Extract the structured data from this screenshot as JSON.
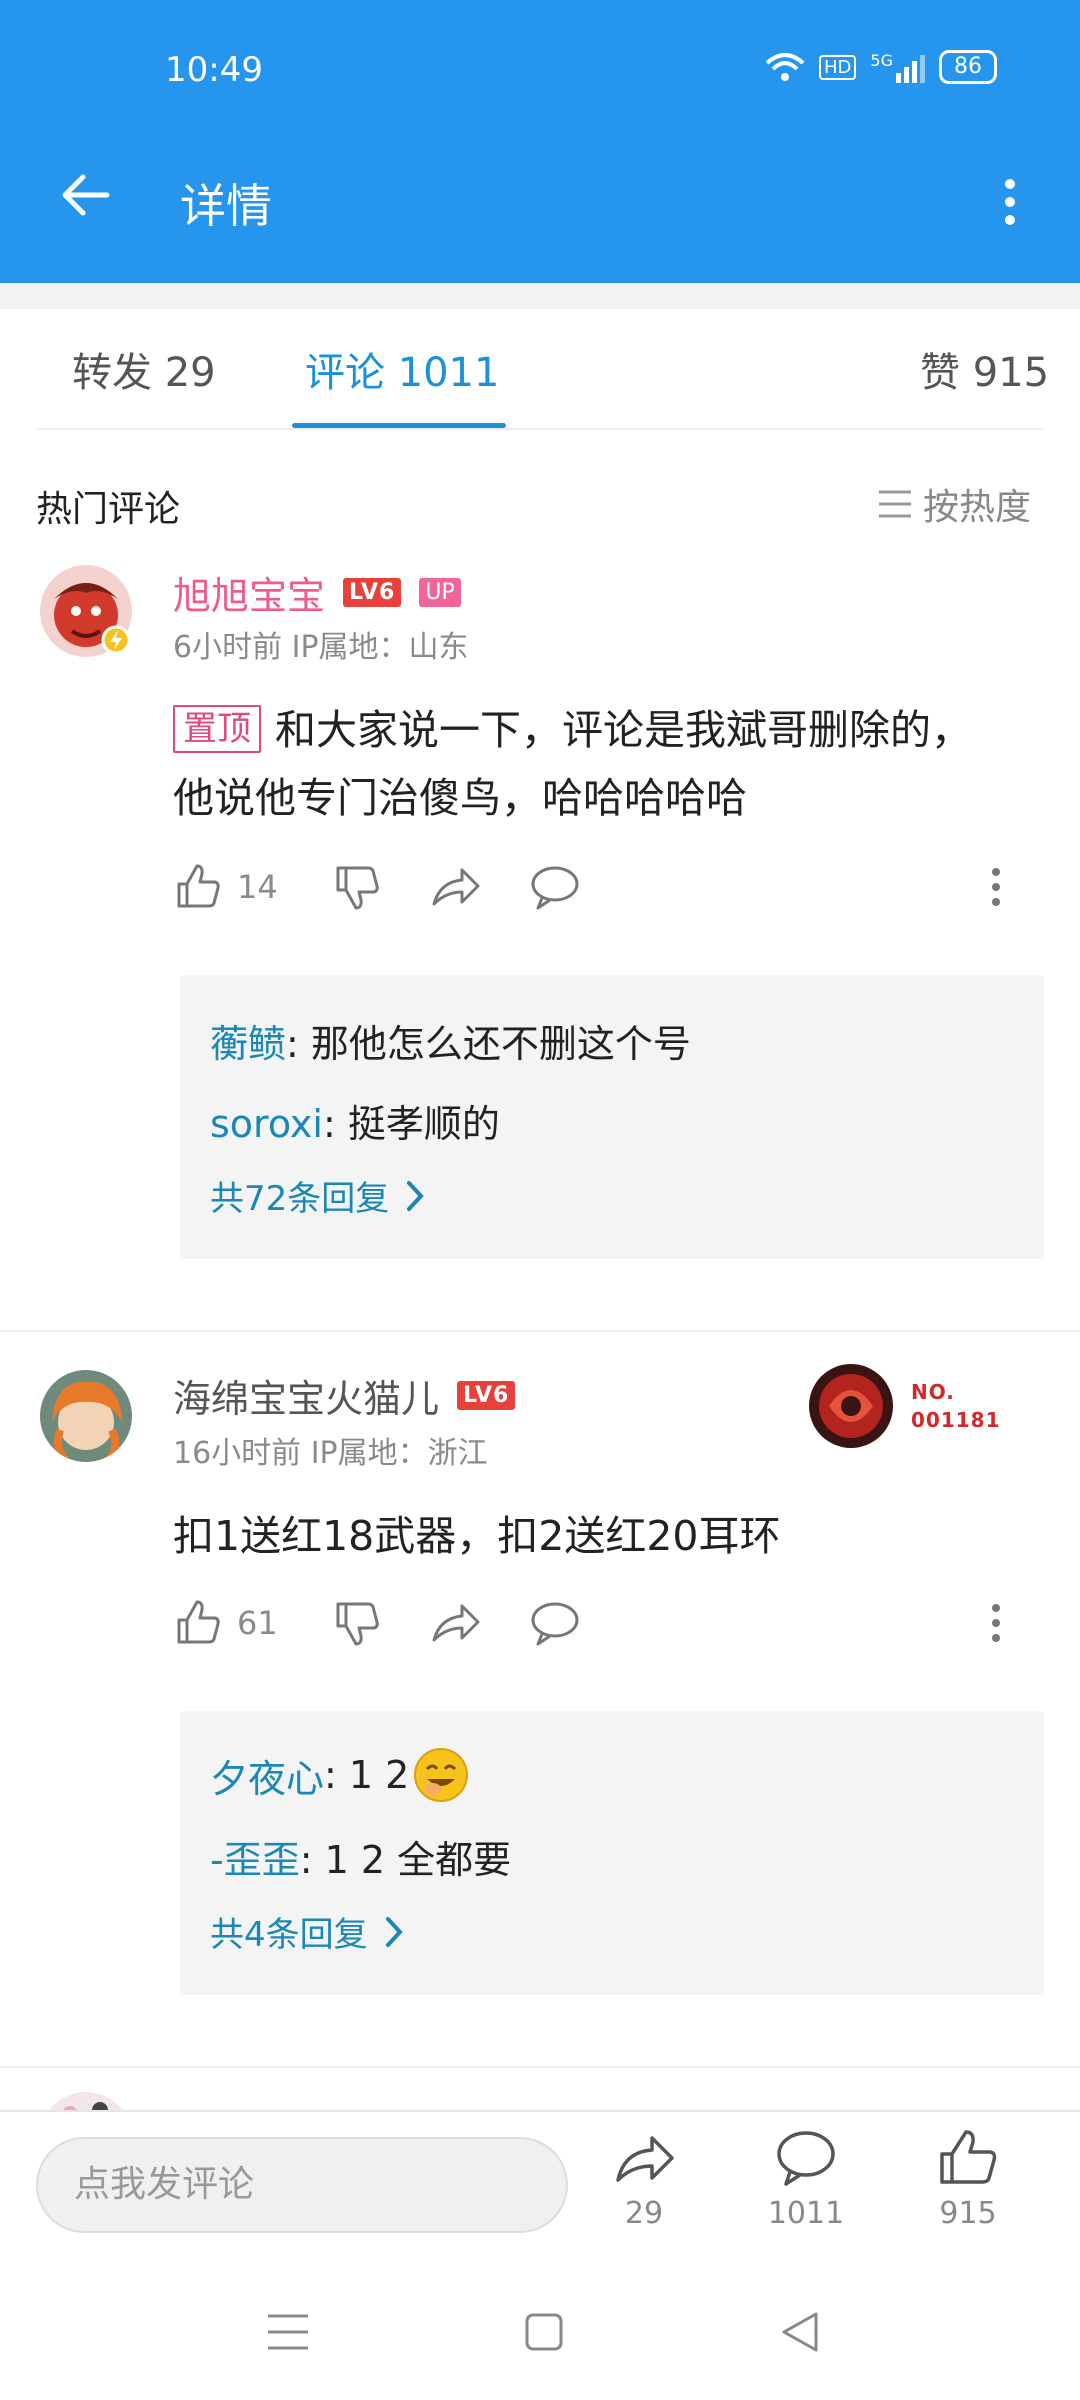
{
  "status_bar": {
    "time": "10:49",
    "network": "5G",
    "hd": "HD",
    "battery": "86"
  },
  "header": {
    "title": "详情"
  },
  "tabs": [
    {
      "label": "转发 29"
    },
    {
      "label": "评论 1011"
    },
    {
      "label": "赞 915"
    }
  ],
  "section": {
    "title": "热门评论",
    "sort_label": "按热度"
  },
  "comments": [
    {
      "username": "旭旭宝宝",
      "level": "LV6",
      "up_badge": "UP",
      "meta": "6小时前  IP属地：山东",
      "pin_label": "置顶",
      "text": "和大家说一下，评论是我斌哥删除的，他说他专门治傻鸟，哈哈哈哈哈",
      "likes": "14",
      "replies": [
        {
          "user": "蘅鲼",
          "text": ": 那他怎么还不删这个号"
        },
        {
          "user": "soroxi",
          "text": ": 挺孝顺的"
        }
      ],
      "more_replies": "共72条回复"
    },
    {
      "username": "海绵宝宝火猫儿",
      "level": "LV6",
      "medal_line1": "NO.",
      "medal_line2": "001181",
      "meta": "16小时前  IP属地：浙江",
      "text": "扣1送红18武器，扣2送红20耳环",
      "likes": "61",
      "replies": [
        {
          "user": "夕夜心",
          "text": ": 1   2"
        },
        {
          "user": "-歪歪",
          "text": ": 1  2  全都要"
        }
      ],
      "more_replies": "共4条回复"
    }
  ],
  "bottom_bar": {
    "input_placeholder": "点我发评论",
    "forward_count": "29",
    "comment_count": "1011",
    "like_count": "915"
  }
}
